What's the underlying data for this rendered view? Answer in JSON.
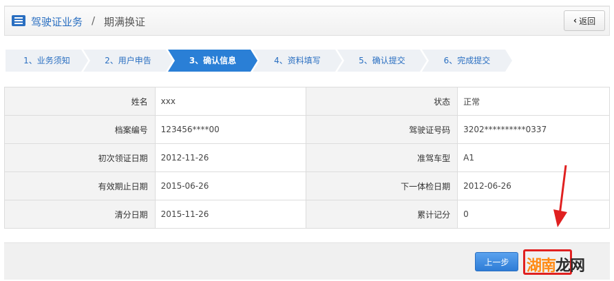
{
  "header": {
    "breadcrumb": "驾驶证业务",
    "separator": "/",
    "subtitle": "期满换证",
    "back_label": "返回"
  },
  "steps": [
    {
      "label": "1、业务须知",
      "active": false
    },
    {
      "label": "2、用户申告",
      "active": false
    },
    {
      "label": "3、确认信息",
      "active": true
    },
    {
      "label": "4、资料填写",
      "active": false
    },
    {
      "label": "5、确认提交",
      "active": false
    },
    {
      "label": "6、完成提交",
      "active": false
    }
  ],
  "info": {
    "name_label": "姓名",
    "name_value": "xxx",
    "status_label": "状态",
    "status_value": "正常",
    "file_no_label": "档案编号",
    "file_no_value": "123456****00",
    "license_no_label": "驾驶证号码",
    "license_no_value": "3202**********0337",
    "first_date_label": "初次领证日期",
    "first_date_value": "2012-11-26",
    "vehicle_type_label": "准驾车型",
    "vehicle_type_value": "A1",
    "valid_until_label": "有效期止日期",
    "valid_until_value": "2015-06-26",
    "next_exam_label": "下一体检日期",
    "next_exam_value": "2012-06-26",
    "clear_date_label": "清分日期",
    "clear_date_value": "2015-11-26",
    "points_label": "累计记分",
    "points_value": "0"
  },
  "footer": {
    "prev_label": "上一步",
    "watermark_main": "湖南",
    "watermark_last": "龙网"
  },
  "colors": {
    "accent": "#2a7fd6",
    "annotation": "#e02020",
    "watermark": "#ff8a14"
  }
}
